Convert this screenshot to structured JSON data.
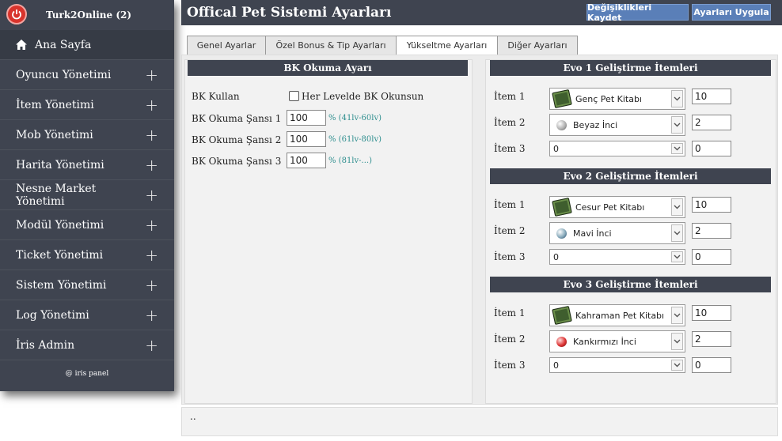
{
  "sidebar": {
    "brand": "Turk2Online (2)",
    "home": "Ana Sayfa",
    "items": [
      "Oyuncu Yönetimi",
      "İtem Yönetimi",
      "Mob Yönetimi",
      "Harita Yönetimi",
      "Nesne Market Yönetimi",
      "Modül Yönetimi",
      "Ticket Yönetimi",
      "Sistem Yönetimi",
      "Log Yönetimi",
      "İris Admin"
    ],
    "footer": "@ iris panel"
  },
  "header": {
    "title": "Offical Pet Sistemi Ayarları",
    "save": "Değişiklikleri Kaydet",
    "apply": "Ayarları Uygula"
  },
  "tabs": [
    "Genel Ayarlar",
    "Özel Bonus & Tip Ayarları",
    "Yükseltme Ayarları",
    "Diğer Ayarları"
  ],
  "bk": {
    "title": "BK Okuma Ayarı",
    "use_label": "BK Kullan",
    "checkbox_label": "Her Levelde BK Okunsun",
    "rows": [
      {
        "label": "BK Okuma Şansı 1",
        "value": "100",
        "hint": "% (41lv-60lv)"
      },
      {
        "label": "BK Okuma Şansı 2",
        "value": "100",
        "hint": "% (61lv-80lv)"
      },
      {
        "label": "BK Okuma Şansı 3",
        "value": "100",
        "hint": "% (81lv-...)"
      }
    ]
  },
  "evo": [
    {
      "title": "Evo 1 Geliştirme İtemleri",
      "rows": [
        {
          "label": "İtem 1",
          "item": "Genç Pet Kitabı",
          "icon": "book-icon",
          "qty": "10"
        },
        {
          "label": "İtem 2",
          "item": "Beyaz İnci",
          "icon": "white-pearl-icon",
          "qty": "2"
        },
        {
          "label": "İtem 3",
          "item": "0",
          "icon": "",
          "qty": "0"
        }
      ]
    },
    {
      "title": "Evo 2 Geliştirme İtemleri",
      "rows": [
        {
          "label": "İtem 1",
          "item": "Cesur Pet Kitabı",
          "icon": "book-icon",
          "qty": "10"
        },
        {
          "label": "İtem 2",
          "item": "Mavi İnci",
          "icon": "blue-pearl-icon",
          "qty": "2"
        },
        {
          "label": "İtem 3",
          "item": "0",
          "icon": "",
          "qty": "0"
        }
      ]
    },
    {
      "title": "Evo 3 Geliştirme İtemleri",
      "rows": [
        {
          "label": "İtem 1",
          "item": "Kahraman Pet Kitabı",
          "icon": "book-icon",
          "qty": "10"
        },
        {
          "label": "İtem 2",
          "item": "Kankırmızı İnci",
          "icon": "red-pearl-icon",
          "qty": "2"
        },
        {
          "label": "İtem 3",
          "item": "0",
          "icon": "",
          "qty": "0"
        }
      ]
    }
  ],
  "footer": {
    "text": ".."
  },
  "colors": {
    "dark": "#3f4450",
    "button": "#5a7fb8",
    "hint": "#2f8f8f"
  }
}
